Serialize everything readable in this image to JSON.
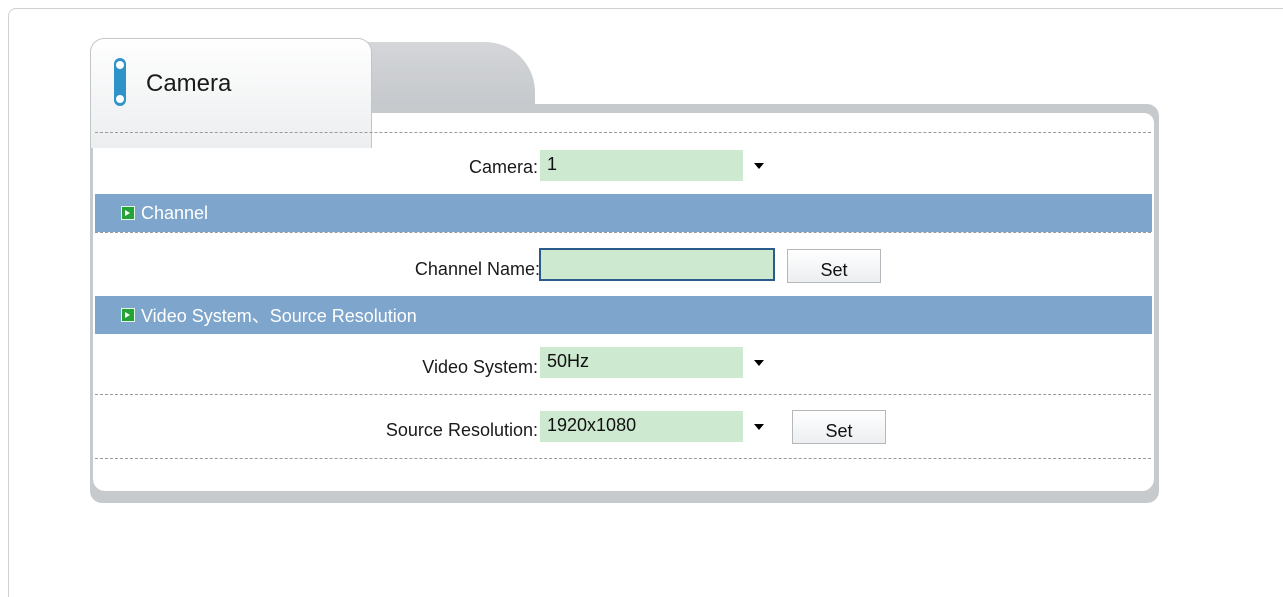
{
  "tab": {
    "title": "Camera"
  },
  "camera_row": {
    "label": "Camera:",
    "value": "1"
  },
  "channel_section": {
    "title": "Channel"
  },
  "channel_name_row": {
    "label": "Channel Name:",
    "value": "",
    "set_label": "Set"
  },
  "video_section": {
    "title": "Video System、Source Resolution"
  },
  "video_system_row": {
    "label": "Video System:",
    "value": "50Hz"
  },
  "source_resolution_row": {
    "label": "Source Resolution:",
    "value": "1920x1080",
    "set_label": "Set"
  },
  "colors": {
    "section_bar": "#7ea5cb",
    "field_fill": "#cde9d0",
    "input_border": "#2d5a8c",
    "section_icon": "#24a338",
    "tab_icon": "#2f93c9"
  }
}
